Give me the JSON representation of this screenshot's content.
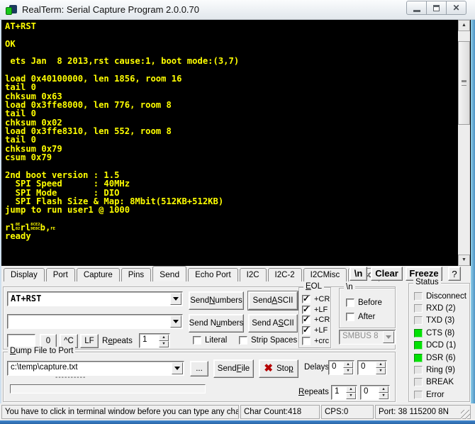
{
  "window": {
    "title": "RealTerm: Serial Capture Program 2.0.0.70"
  },
  "colors": {
    "terminal_fg": "#FFFF00",
    "terminal_bg": "#000000",
    "led_on": "#00E103",
    "frame_blue": "#3C7FB1"
  },
  "terminal": {
    "lines": [
      "AT+RST",
      "",
      "OK",
      "",
      " ets Jan  8 2013,rst cause:1, boot mode:(3,7)",
      "",
      "load 0x40100000, len 1856, room 16",
      "tail 0",
      "chksum 0x63",
      "load 0x3ffe8000, len 776, room 8",
      "tail 0",
      "chksum 0x02",
      "load 0x3ffe8310, len 552, room 8",
      "tail 0",
      "chksum 0x79",
      "csum 0x79",
      "",
      "2nd boot version : 1.5",
      "  SPI Speed      : 40MHz",
      "  SPI Mode       : DIO",
      "  SPI Flash Size & Map: 8Mbit(512KB+512KB)",
      "jump to run user1 @ 1000",
      "",
      [
        {
          "t": "rl"
        },
        {
          "s": [
            "8E",
            "82"
          ]
        },
        {
          "t": "rl"
        },
        {
          "s": [
            "8C",
            "9E"
          ]
        },
        {
          "s": [
            "E2",
            "8C"
          ]
        },
        {
          "t": "b,"
        },
        {
          "s": [
            "FE",
            ""
          ]
        }
      ],
      "ready"
    ]
  },
  "tabs": {
    "active": "Send",
    "items": [
      "Display",
      "Port",
      "Capture",
      "Pins",
      "Send",
      "Echo Port",
      "I2C",
      "I2C-2",
      "I2CMisc",
      "Misc"
    ],
    "newline_btn": "\\n",
    "clear_btn": "Clear",
    "freeze_btn": "Freeze",
    "help_btn": "?"
  },
  "send": {
    "history1": "AT+RST",
    "history2": "",
    "row1_send_numbers": "Send [N]umbers",
    "row1_send_ascii": "Send [A]SCII",
    "row2_send_numbers": "Send N[u]mbers",
    "row2_send_ascii": "Send A[S]CII",
    "char_field": "",
    "btn_zero": "0",
    "btn_ctrlc": "^C",
    "btn_lf": "LF",
    "repeats_label": "R[e]peats",
    "repeats_value": "1",
    "literal_label": "Literal",
    "literal_checked": false,
    "strip_spaces_label": "Strip Spaces",
    "strip_spaces_checked": false,
    "eol": {
      "label": "[E]OL",
      "items": [
        {
          "label": "+CR",
          "checked": true
        },
        {
          "label": "+LF",
          "checked": true
        },
        {
          "label": "+CR",
          "checked": true
        },
        {
          "label": "+LF",
          "checked": true
        },
        {
          "label": "+crc",
          "checked": false
        }
      ]
    },
    "newline_group": {
      "label": "\\n",
      "before_label": "Before",
      "before_checked": false,
      "after_label": "After",
      "after_checked": false
    },
    "smbus_value": "SMBUS 8"
  },
  "status_panel": {
    "label": "Status",
    "items": [
      {
        "label": "Disconnect",
        "on": false
      },
      {
        "label": "RXD (2)",
        "on": false
      },
      {
        "label": "TXD (3)",
        "on": false
      },
      {
        "label": "CTS (8)",
        "on": true
      },
      {
        "label": "DCD (1)",
        "on": true
      },
      {
        "label": "DSR (6)",
        "on": true
      },
      {
        "label": "Ring (9)",
        "on": false
      },
      {
        "label": "BREAK",
        "on": false
      },
      {
        "label": "Error",
        "on": false
      }
    ]
  },
  "dump": {
    "label": "[D]ump File to Port",
    "file": "c:\\temp\\capture.txt",
    "browse": "...",
    "send_file": "Send [F]ile",
    "stop": "Sto[p]",
    "delays_label": "Delays",
    "delays": [
      "0",
      "0"
    ],
    "dashes": "----------",
    "repeats_label": "[R]epeats",
    "repeats": [
      "1",
      "0"
    ]
  },
  "statusbar": {
    "message": "You have to click in terminal window before you can type any cha",
    "char_count": "Char Count:418",
    "cps": "CPS:0",
    "port": "Port: 38 115200 8N"
  }
}
